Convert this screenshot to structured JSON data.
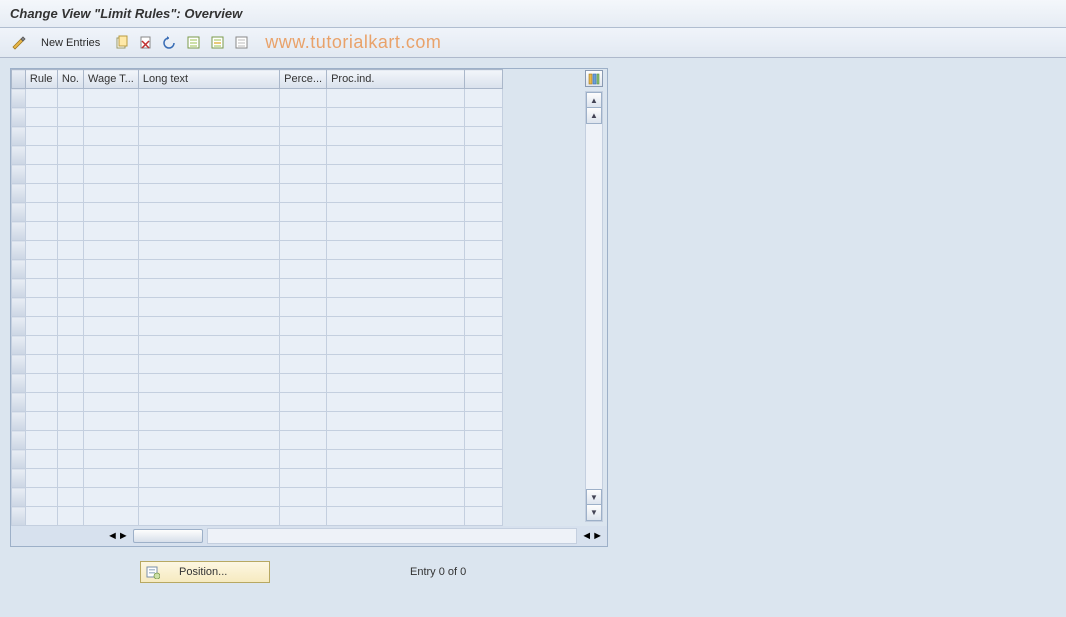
{
  "title": "Change View \"Limit Rules\": Overview",
  "toolbar": {
    "new_entries": "New Entries"
  },
  "watermark": "www.tutorialkart.com",
  "table": {
    "columns": [
      "Rule",
      "No.",
      "Wage T...",
      "Long text",
      "Perce...",
      "Proc.ind."
    ],
    "rows": 23
  },
  "footer": {
    "position_label": "Position...",
    "entry_text": "Entry 0 of 0"
  }
}
